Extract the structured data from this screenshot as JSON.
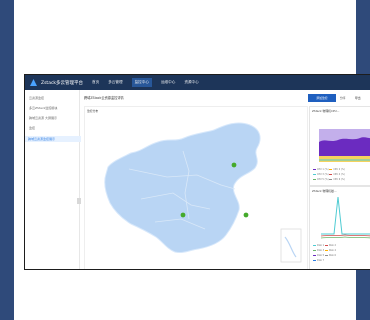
{
  "app": {
    "brand": "Zstack多云管理平台",
    "nav": [
      "首页",
      "多云管理",
      "监控中心",
      "运维中心",
      "资源中心"
    ],
    "active_nav_index": 2
  },
  "sidebar": {
    "items": [
      {
        "label": "云资源监控"
      },
      {
        "label": "多云ZStack监控模块"
      },
      {
        "label": "跨域云资源   大屏展示"
      },
      {
        "label": "监控"
      },
      {
        "label": "跨域云资源监控展示"
      }
    ],
    "selected_index": 4
  },
  "main": {
    "breadcrumb": "跨域ZStack云资源监控详情",
    "buttons": [
      "添加监控",
      "分享",
      "导出"
    ],
    "map_panel_title": "监控分布",
    "right_panel_1_title": "ZStack 物理机CPU…",
    "right_panel_2_title": "ZStack 物理机磁…",
    "legend_1": [
      "CPU 1 (%)",
      "CPU 2 (%)",
      "CPU 3 (%)",
      "CPU 4 (%)",
      "CPU 5 (%)",
      "CPU 6 (%)"
    ],
    "legend_2": [
      "Disk 1",
      "Disk 2",
      "Disk 3",
      "Disk 4",
      "Disk 5",
      "Disk 6",
      "Disk 7"
    ]
  },
  "colors": {
    "page_bars": "#2f4a7a",
    "topnav": "#1d3559",
    "map_fill": "#b9d5f4",
    "marker": "#44aa2b"
  }
}
